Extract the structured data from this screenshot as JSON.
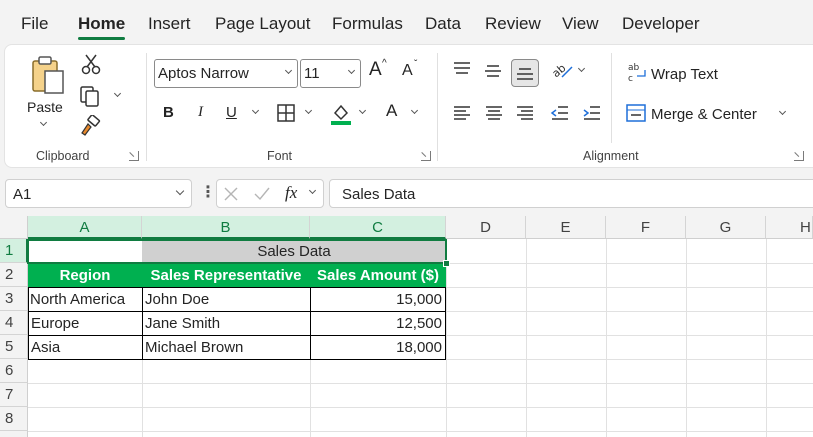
{
  "menu": {
    "tabs": [
      "File",
      "Home",
      "Insert",
      "Page Layout",
      "Formulas",
      "Data",
      "Review",
      "View",
      "Developer"
    ],
    "active": "Home"
  },
  "ribbon": {
    "clipboard": {
      "paste_label": "Paste",
      "group_label": "Clipboard"
    },
    "font": {
      "font_name": "Aptos Narrow",
      "font_size": "11",
      "bold": "B",
      "italic": "I",
      "underline": "U",
      "font_color": "A",
      "grow": "A",
      "shrink": "A",
      "group_label": "Font"
    },
    "alignment": {
      "wrap_text": "Wrap Text",
      "merge_center": "Merge & Center",
      "group_label": "Alignment"
    }
  },
  "formula_bar": {
    "name_box": "A1",
    "formula": "Sales Data",
    "fx": "fx"
  },
  "grid": {
    "columns": [
      "A",
      "B",
      "C",
      "D",
      "E",
      "F",
      "G",
      "H"
    ],
    "rows": [
      "1",
      "2",
      "3",
      "4",
      "5",
      "6",
      "7",
      "8"
    ],
    "title": "Sales Data",
    "headers": [
      "Region",
      "Sales Representative",
      "Sales Amount ($)"
    ],
    "data": [
      [
        "North America",
        "John Doe",
        "15,000"
      ],
      [
        "Europe",
        "Jane Smith",
        "12,500"
      ],
      [
        "Asia",
        "Michael Brown",
        "18,000"
      ]
    ]
  },
  "colors": {
    "accent": "#107c41",
    "header_fill": "#00b050",
    "merged_fill": "#d0d0d0"
  }
}
